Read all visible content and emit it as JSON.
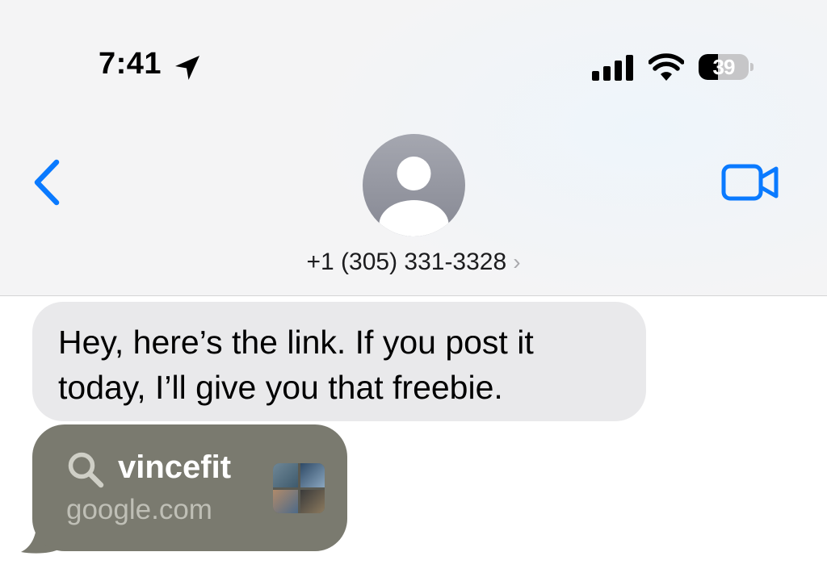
{
  "status_bar": {
    "time": "7:41",
    "battery": "39",
    "battery_level": 0.39,
    "icons": [
      "location-arrow-icon",
      "cellular-signal-icon",
      "wifi-icon",
      "battery-icon"
    ]
  },
  "header": {
    "contact": "+1 (305) 331-3328",
    "chevron": "›",
    "icons": [
      "back-chevron-icon",
      "contact-avatar",
      "video-call-icon"
    ],
    "accent_color": "#0a7aff"
  },
  "messages": [
    {
      "text": "Hey, here’s the link. If you post it today, I’ll give you that freebie.",
      "kind": "incoming"
    },
    {
      "kind": "link-preview",
      "title": "vincefit",
      "domain": "google.com",
      "icon": "search-icon",
      "bubble_color": "#7a7a6f"
    }
  ]
}
